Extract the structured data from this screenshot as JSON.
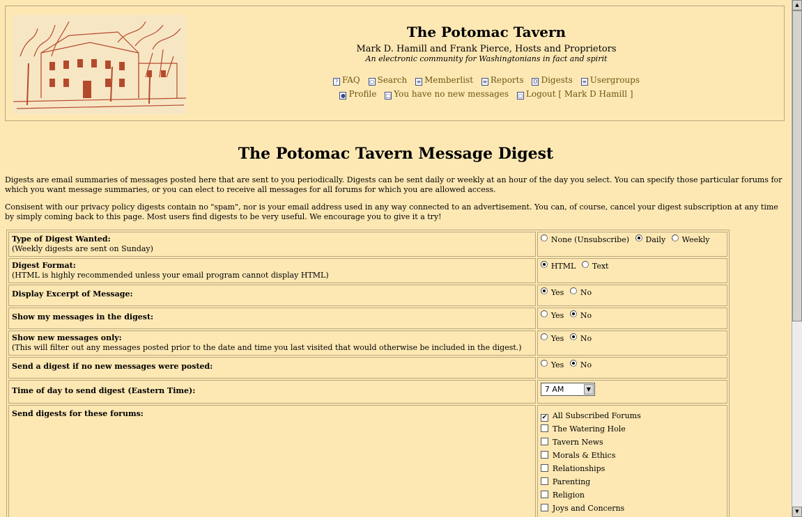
{
  "header": {
    "title": "The Potomac Tavern",
    "subtitle": "Mark D. Hamill and Frank Pierce, Hosts and Proprietors",
    "tagline": "An electronic community for Washingtonians in fact and spirit",
    "nav_row1": [
      {
        "label": "FAQ",
        "icon": "help-icon"
      },
      {
        "label": "Search",
        "icon": "search-icon"
      },
      {
        "label": "Memberlist",
        "icon": "memberlist-icon"
      },
      {
        "label": "Reports",
        "icon": "reports-icon"
      },
      {
        "label": "Digests",
        "icon": "digests-icon"
      },
      {
        "label": "Usergroups",
        "icon": "usergroups-icon"
      }
    ],
    "nav_row2": [
      {
        "label": "Profile",
        "icon": "profile-icon"
      },
      {
        "label": "You have no new messages",
        "icon": "messages-icon"
      },
      {
        "label": "Logout [ Mark D Hamill ]",
        "icon": "logout-icon"
      }
    ]
  },
  "page": {
    "title": "The Potomac Tavern Message Digest",
    "intro1": "Digests are email summaries of messages posted here that are sent to you periodically. Digests can be sent daily or weekly at an hour of the day you select. You can specify those particular forums for which you want message summaries, or you can elect to receive all messages for all forums for which you are allowed access.",
    "intro2": "Consisent with our privacy policy digests contain no \"spam\", nor is your email address used in any way connected to an advertisement. You can, of course, cancel your digest subscription at any time by simply coming back to this page. Most users find digests to be very useful. We encourage you to give it a try!"
  },
  "form": {
    "type": {
      "label": "Type of Digest Wanted:",
      "note": "(Weekly digests are sent on Sunday)",
      "options": [
        "None (Unsubscribe)",
        "Daily",
        "Weekly"
      ],
      "selected": "Daily"
    },
    "format": {
      "label": "Digest Format:",
      "note": "(HTML is highly recommended unless your email program cannot display HTML)",
      "options": [
        "HTML",
        "Text"
      ],
      "selected": "HTML"
    },
    "excerpt": {
      "label": "Display Excerpt of Message:",
      "options": [
        "Yes",
        "No"
      ],
      "selected": "Yes"
    },
    "show_mine": {
      "label": "Show my messages in the digest:",
      "options": [
        "Yes",
        "No"
      ],
      "selected": "No"
    },
    "new_only": {
      "label": "Show new messages only:",
      "note": "(This will filter out any messages posted prior to the date and time you last visited that would otherwise be included in the digest.)",
      "options": [
        "Yes",
        "No"
      ],
      "selected": "No"
    },
    "send_empty": {
      "label": "Send a digest if no new messages were posted:",
      "options": [
        "Yes",
        "No"
      ],
      "selected": "No"
    },
    "time": {
      "label": "Time of day to send digest (Eastern Time):",
      "value": "7 AM"
    },
    "forums": {
      "label": "Send digests for these forums:",
      "items": [
        {
          "label": "All Subscribed Forums",
          "checked": true
        },
        {
          "label": "The Watering Hole",
          "checked": false
        },
        {
          "label": "Tavern News",
          "checked": false
        },
        {
          "label": "Morals & Ethics",
          "checked": false
        },
        {
          "label": "Relationships",
          "checked": false
        },
        {
          "label": "Parenting",
          "checked": false
        },
        {
          "label": "Religion",
          "checked": false
        },
        {
          "label": "Joys and Concerns",
          "checked": false
        }
      ]
    }
  }
}
